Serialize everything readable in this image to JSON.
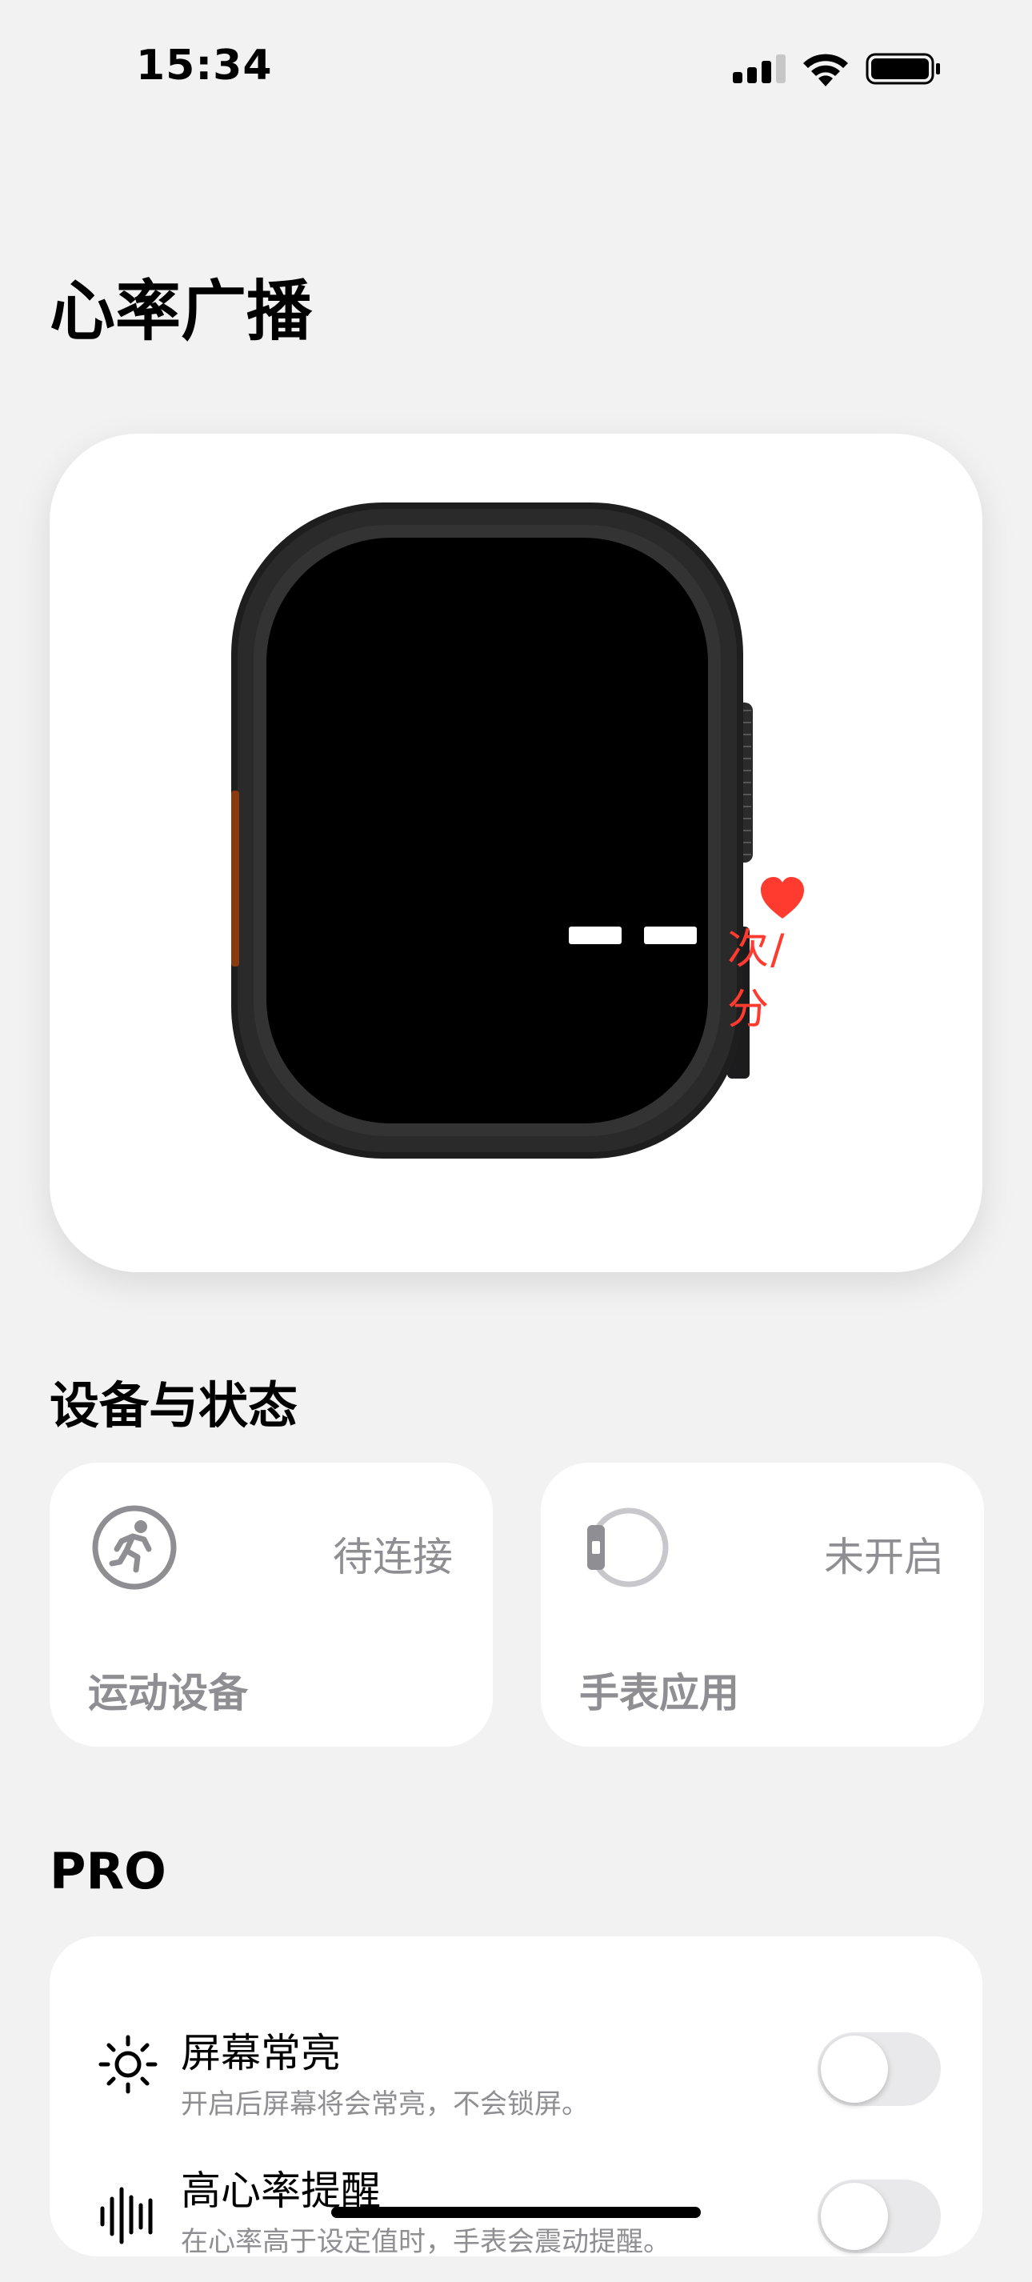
{
  "status_bar": {
    "time": "15:34",
    "signal_icon": "cellular-signal-icon",
    "wifi_icon": "wifi-icon",
    "battery_icon": "battery-icon"
  },
  "page": {
    "title": "心率广播"
  },
  "hero": {
    "heart_rate_value": "— —",
    "unit": "次/分",
    "heart_color": "#ff3b30",
    "watch_icon": "apple-watch-ultra-icon"
  },
  "devices": {
    "section_title": "设备与状态",
    "cards": [
      {
        "label": "运动设备",
        "status": "待连接",
        "icon": "running-figure-icon"
      },
      {
        "label": "手表应用",
        "status": "未开启",
        "icon": "watch-outline-icon"
      }
    ]
  },
  "pro": {
    "section_title": "PRO",
    "items": [
      {
        "title": "屏幕常亮",
        "description": "开启后屏幕将会常亮，不会锁屏。",
        "icon": "sun-icon",
        "enabled": false
      },
      {
        "title": "高心率提醒",
        "description": "在心率高于设定值时，手表会震动提醒。",
        "icon": "waveform-icon",
        "enabled": false
      }
    ]
  }
}
